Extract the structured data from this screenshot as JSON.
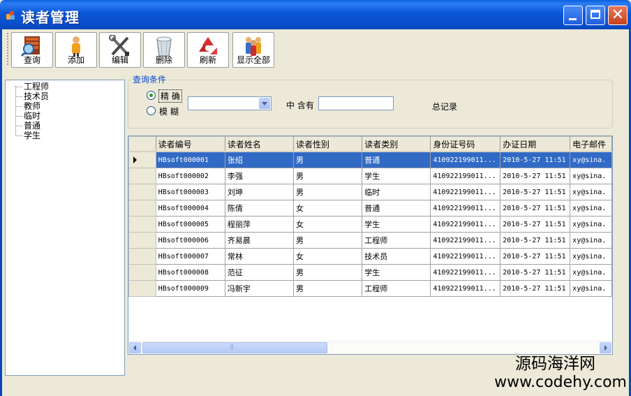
{
  "window": {
    "title": "读者管理"
  },
  "toolbar": {
    "buttons": [
      {
        "label": "查询",
        "icon": "search-records-icon"
      },
      {
        "label": "添加",
        "icon": "add-user-icon"
      },
      {
        "label": "编辑",
        "icon": "tools-edit-icon"
      },
      {
        "label": "删除",
        "icon": "recycle-bin-icon"
      },
      {
        "label": "刷新",
        "icon": "refresh-recycle-icon"
      },
      {
        "label": "显示全部",
        "icon": "people-group-icon"
      }
    ]
  },
  "tree": {
    "items": [
      "工程师",
      "技术员",
      "教师",
      "临时",
      "普通",
      "学生"
    ]
  },
  "query": {
    "group_title": "查询条件",
    "exact_label": "精  确",
    "fuzzy_label": "模  糊",
    "contains_label": "中 含有",
    "total_label": "总记录",
    "field_value": "",
    "keyword_value": ""
  },
  "grid": {
    "columns": [
      "读者编号",
      "读者姓名",
      "读者性别",
      "读者类别",
      "身份证号码",
      "办证日期",
      "电子邮件"
    ],
    "rows": [
      [
        "HBsoft000001",
        "张绍",
        "男",
        "普通",
        "410922199011...",
        "2010-5-27 11:51",
        "xy@sina."
      ],
      [
        "HBsoft000002",
        "李强",
        "男",
        "学生",
        "410922199011...",
        "2010-5-27 11:51",
        "xy@sina."
      ],
      [
        "HBsoft000003",
        "刘坤",
        "男",
        "临时",
        "410922199011...",
        "2010-5-27 11:51",
        "xy@sina."
      ],
      [
        "HBsoft000004",
        "陈倩",
        "女",
        "普通",
        "410922199011...",
        "2010-5-27 11:51",
        "xy@sina."
      ],
      [
        "HBsoft000005",
        "程丽萍",
        "女",
        "学生",
        "410922199011...",
        "2010-5-27 11:51",
        "xy@sina."
      ],
      [
        "HBsoft000006",
        "齐易晨",
        "男",
        "工程师",
        "410922199011...",
        "2010-5-27 11:51",
        "xy@sina."
      ],
      [
        "HBsoft000007",
        "常林",
        "女",
        "技术员",
        "410922199011...",
        "2010-5-27 11:51",
        "xy@sina."
      ],
      [
        "HBsoft000008",
        "范征",
        "男",
        "学生",
        "410922199011...",
        "2010-5-27 11:51",
        "xy@sina."
      ],
      [
        "HBsoft000009",
        "冯新宇",
        "男",
        "工程师",
        "410922199011...",
        "2010-5-27 11:51",
        "xy@sina."
      ]
    ],
    "selected_row": 0
  },
  "watermark": {
    "line1": "源码海洋网",
    "line2": "www.codehy.com"
  },
  "colors": {
    "titlebar": "#0A4FCC",
    "selection": "#316AC5",
    "group_title": "#0046D5",
    "close_button": "#C8401E"
  }
}
